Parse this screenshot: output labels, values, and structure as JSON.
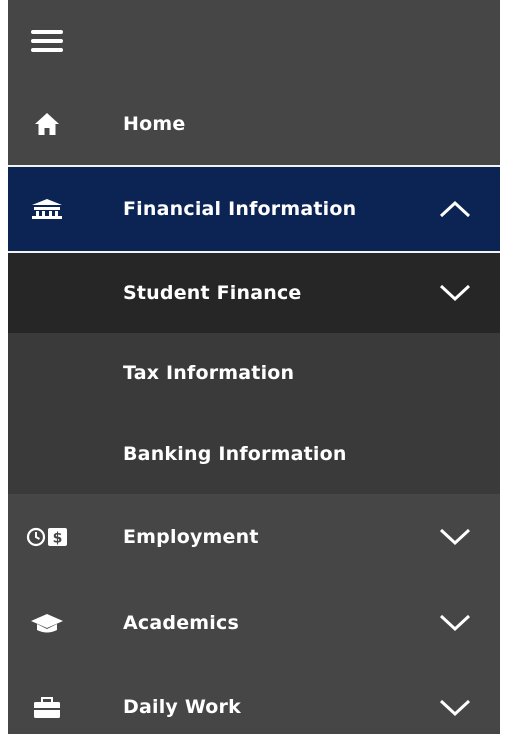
{
  "menu": {
    "menu_icon": "hamburger-icon",
    "items": [
      {
        "label": "Home",
        "icon": "home-icon"
      },
      {
        "label": "Financial Information",
        "icon": "bank-icon",
        "chevron": "chevron-up-icon",
        "expanded": true
      },
      {
        "label": "Employment",
        "icon": "clock-dollar-icon",
        "chevron": "chevron-down-icon"
      },
      {
        "label": "Academics",
        "icon": "graduation-cap-icon",
        "chevron": "chevron-down-icon"
      },
      {
        "label": "Daily Work",
        "icon": "briefcase-icon",
        "chevron": "chevron-down-icon"
      }
    ],
    "submenu": [
      {
        "label": "Student Finance",
        "chevron": "chevron-down-icon"
      },
      {
        "label": "Tax Information"
      },
      {
        "label": "Banking Information"
      }
    ]
  },
  "colors": {
    "menu_bg": "#464646",
    "active_bg": "#0b2453",
    "submenu_header_bg": "#262626",
    "submenu_bg": "#3a3a3a",
    "text": "#ffffff"
  }
}
